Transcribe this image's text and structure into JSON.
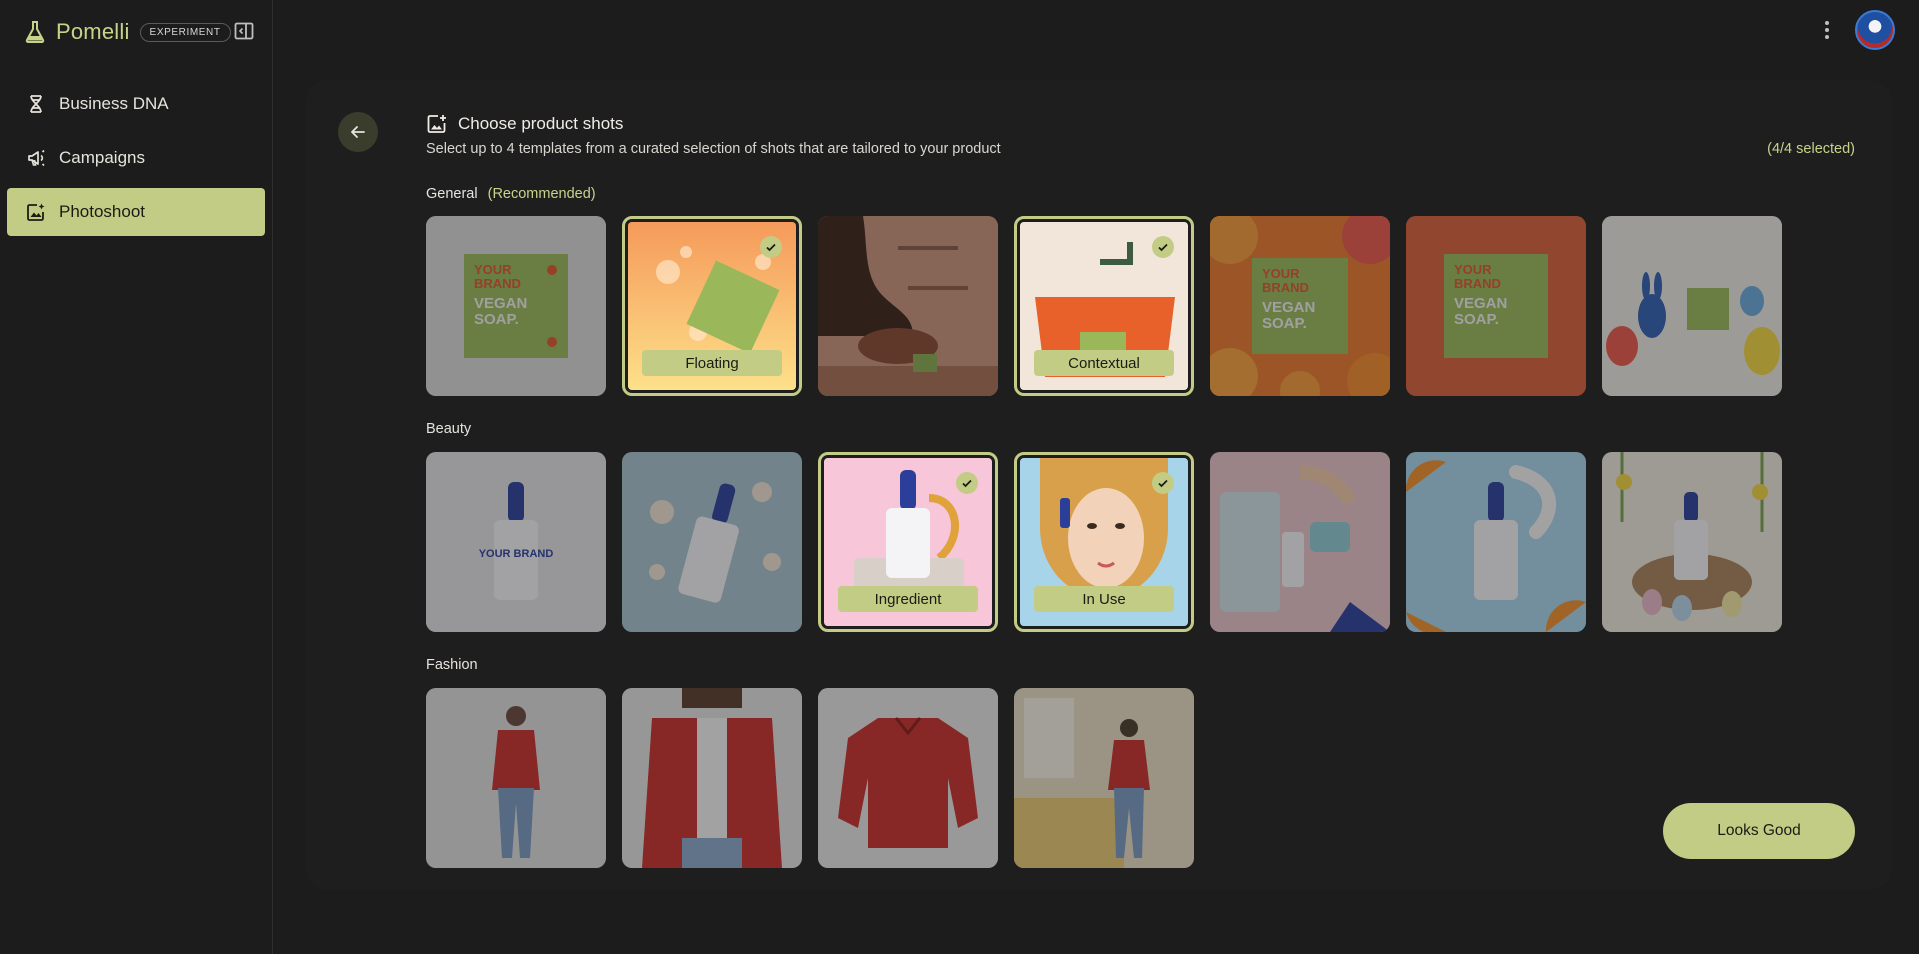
{
  "app": {
    "name": "Pomelli",
    "badge": "EXPERIMENT"
  },
  "sidebar": {
    "items": [
      {
        "label": "Business DNA",
        "icon": "dna-icon",
        "active": false
      },
      {
        "label": "Campaigns",
        "icon": "megaphone-icon",
        "active": false
      },
      {
        "label": "Photoshoot",
        "icon": "photo-sparkle-icon",
        "active": true
      }
    ]
  },
  "header": {
    "title": "Choose product shots",
    "subtitle": "Select up to 4 templates from a curated selection of shots that are tailored to your product",
    "count": "(4/4 selected)"
  },
  "sections": {
    "general": {
      "label": "General",
      "recommended": "(Recommended)",
      "tiles": [
        {
          "selected": false,
          "label": ""
        },
        {
          "selected": true,
          "label": "Floating"
        },
        {
          "selected": false,
          "label": ""
        },
        {
          "selected": true,
          "label": "Contextual"
        },
        {
          "selected": false,
          "label": ""
        },
        {
          "selected": false,
          "label": ""
        },
        {
          "selected": false,
          "label": ""
        }
      ]
    },
    "beauty": {
      "label": "Beauty",
      "tiles": [
        {
          "selected": false,
          "label": ""
        },
        {
          "selected": false,
          "label": ""
        },
        {
          "selected": true,
          "label": "Ingredient"
        },
        {
          "selected": true,
          "label": "In Use"
        },
        {
          "selected": false,
          "label": ""
        },
        {
          "selected": false,
          "label": ""
        },
        {
          "selected": false,
          "label": ""
        }
      ]
    },
    "fashion": {
      "label": "Fashion",
      "tiles": [
        {
          "selected": false,
          "label": ""
        },
        {
          "selected": false,
          "label": ""
        },
        {
          "selected": false,
          "label": ""
        },
        {
          "selected": false,
          "label": ""
        }
      ]
    }
  },
  "product_text": {
    "box_line1": "YOUR",
    "box_line2": "BRAND",
    "box_line3": "VEGAN",
    "box_line4": "SOAP.",
    "bottle": "YOUR BRAND"
  },
  "actions": {
    "confirm_label": "Looks Good"
  },
  "colors": {
    "accent": "#c2cc84",
    "accent_text": "#c8d38a",
    "background": "#1c1c1d"
  }
}
